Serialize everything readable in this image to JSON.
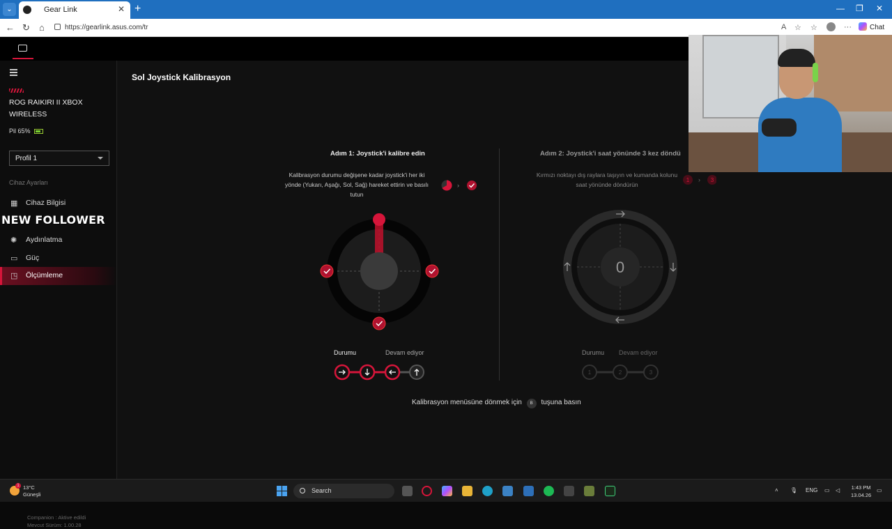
{
  "browser": {
    "tab_title": "Gear Link",
    "url": "https://gearlink.asus.com/tr",
    "chat_label": "Chat"
  },
  "sidebar": {
    "device_name": "ROG RAIKIRI II XBOX WIRELESS",
    "battery": "Pil 65%",
    "profile": "Profil 1",
    "section_title": "Cihaz Ayarları",
    "items": [
      {
        "label": "Cihaz Bilgisi",
        "icon": "grid-icon"
      },
      {
        "label": "Aydınlatma",
        "icon": "light-icon"
      },
      {
        "label": "Güç",
        "icon": "battery-icon"
      },
      {
        "label": "Ölçümleme",
        "icon": "calibration-icon",
        "active": true
      }
    ],
    "overlay_text": "NEW FOLLOWER",
    "companion": "Companion : Aktive edildi",
    "version": "Mevcut Sürüm: 1.00.28"
  },
  "main": {
    "page_title": "Sol Joystick Kalibrasyon",
    "step1": {
      "title": "Adım 1: Joystick'i kalibre edin",
      "description_line1": "Kalibrasyon durumu değişene kadar joystick'i her iki",
      "description_line2": "yönde (Yukarı, Aşağı, Sol, Sağ) hareket ettirin ve basılı",
      "description_line3": "tutun",
      "status_label": "Durumu",
      "status_value": "Devam ediyor"
    },
    "step2": {
      "title": "Adım 2: Joystick'i saat yönünde 3 kez döndü",
      "description_line1": "Kırmızı noktayı dış raylara taşıyın ve kumanda kolunu",
      "description_line2": "saat yönünde döndürün",
      "counter": "0",
      "range_start": "1",
      "range_end": "3",
      "status_label": "Durumu",
      "status_value": "Devam ediyor",
      "steps": [
        "1",
        "2",
        "3"
      ]
    },
    "footer_before": "Kalibrasyon menüsüne dönmek için",
    "footer_button": "B",
    "footer_after": "tuşuna basın"
  },
  "taskbar": {
    "temperature": "13°C",
    "weather": "Güneşli",
    "search": "Search",
    "language": "ENG",
    "time": "1:43 PM",
    "date": "13.04.26",
    "notification_count": "1"
  },
  "colors": {
    "accent": "#d6153a",
    "browser_blue": "#1f6fbf"
  }
}
